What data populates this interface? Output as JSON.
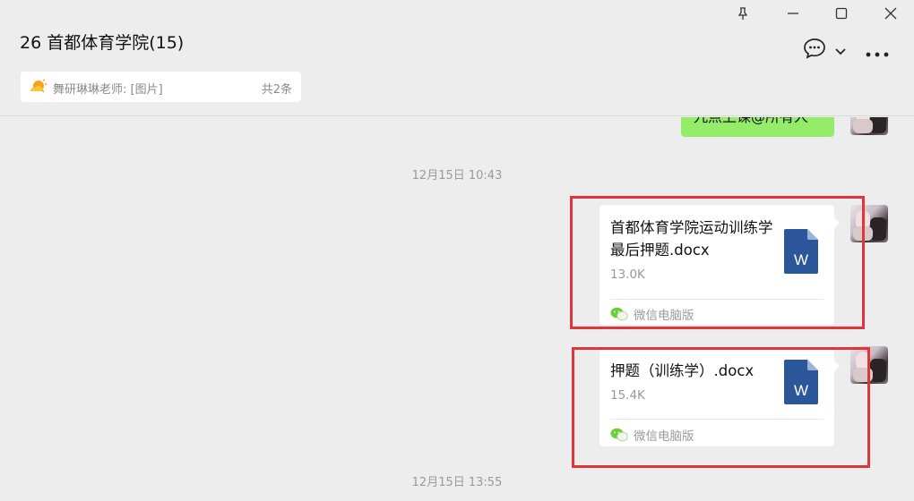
{
  "window": {
    "title": "26 首都体育学院(15)",
    "controls": [
      "pin-icon",
      "minimize-icon",
      "maximize-icon",
      "close-icon"
    ]
  },
  "notice": {
    "text": "舞研琳琳老师: [图片]",
    "count": "共2条"
  },
  "header_actions": [
    "chat-icon",
    "chevron-down-icon",
    "more-icon"
  ],
  "messages": {
    "top_bubble_text": "九点上课@所有人",
    "timestamp_1": "12月15日 10:43",
    "file_1": {
      "name": "首都体育学院运动训练学最后押题.docx",
      "size": "13.0K",
      "source": "微信电脑版",
      "icon_letter": "W"
    },
    "file_2": {
      "name": "押题（训练学）.docx",
      "size": "15.4K",
      "source": "微信电脑版",
      "icon_letter": "W"
    },
    "timestamp_2": "12月15日 13:55"
  },
  "colors": {
    "background": "#ededed",
    "bubble_green": "#95ec69",
    "highlight": "#e0353c",
    "word_blue": "#2b579a"
  }
}
